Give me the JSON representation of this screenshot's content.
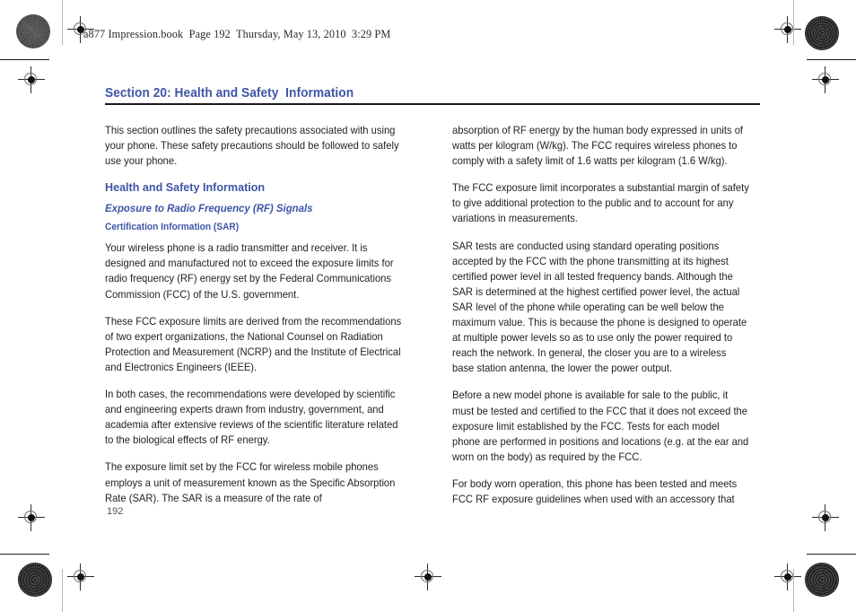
{
  "book_header": "a877 Impression.book  Page 192  Thursday, May 13, 2010  3:29 PM",
  "folio": "192",
  "accent_color": "#3e55a6",
  "rule_color": "#191919",
  "section": {
    "title": "Section 20: Health and Safety  Information"
  },
  "headings": {
    "h2": "Health and Safety Information",
    "h3": "Exposure to Radio Frequency (RF) Signals",
    "h4": "Certification Information (SAR)"
  },
  "left_column": {
    "intro": "This section outlines the safety precautions associated with using your phone. These safety precautions should be followed to safely use your phone.",
    "p1": "Your wireless phone is a radio transmitter and receiver. It is designed and manufactured not to exceed the exposure limits for radio frequency (RF) energy set by the Federal Communications Commission (FCC) of the U.S. government.",
    "p2": "These FCC exposure limits are derived from the recommendations of two expert organizations, the National Counsel on Radiation Protection and Measurement (NCRP) and the Institute of Electrical and Electronics Engineers (IEEE).",
    "p3": "In both cases, the recommendations were developed by scientific and engineering experts drawn from industry, government, and academia after extensive reviews of the scientific literature related to the biological effects of RF energy.",
    "p4": "The exposure limit set by the FCC for wireless mobile phones employs a unit of measurement known as the Specific Absorption Rate (SAR). The SAR is a measure of the rate of"
  },
  "right_column": {
    "p1": "absorption of RF energy by the human body expressed in units of watts per kilogram (W/kg). The FCC requires wireless phones to comply with a safety limit of 1.6 watts per kilogram (1.6 W/kg).",
    "p2": "The FCC exposure limit incorporates a substantial margin of safety to give additional protection to the public and to account for any variations in measurements.",
    "p3": "SAR tests are conducted using standard operating positions accepted by the FCC with the phone transmitting at its highest certified power level in all tested frequency bands. Although the SAR is determined at the highest certified power level, the actual SAR level of the phone while operating can be well below the maximum value. This is because the phone is designed to operate at multiple power levels so as to use only the power required to reach the network. In general, the closer you are to a wireless base station antenna, the lower the power output.",
    "p4": "Before a new model phone is available for sale to the public, it must be tested and certified to the FCC that it does not exceed the exposure limit established by the FCC. Tests for each model phone are performed in positions and locations (e.g. at the ear and worn on the body) as required by the FCC.",
    "p5": "For body worn operation, this phone has been tested and meets FCC RF exposure guidelines when used with an accessory that"
  },
  "print_marks": {
    "registration_label": "registration-target",
    "rosette_label": "color-rosette"
  }
}
